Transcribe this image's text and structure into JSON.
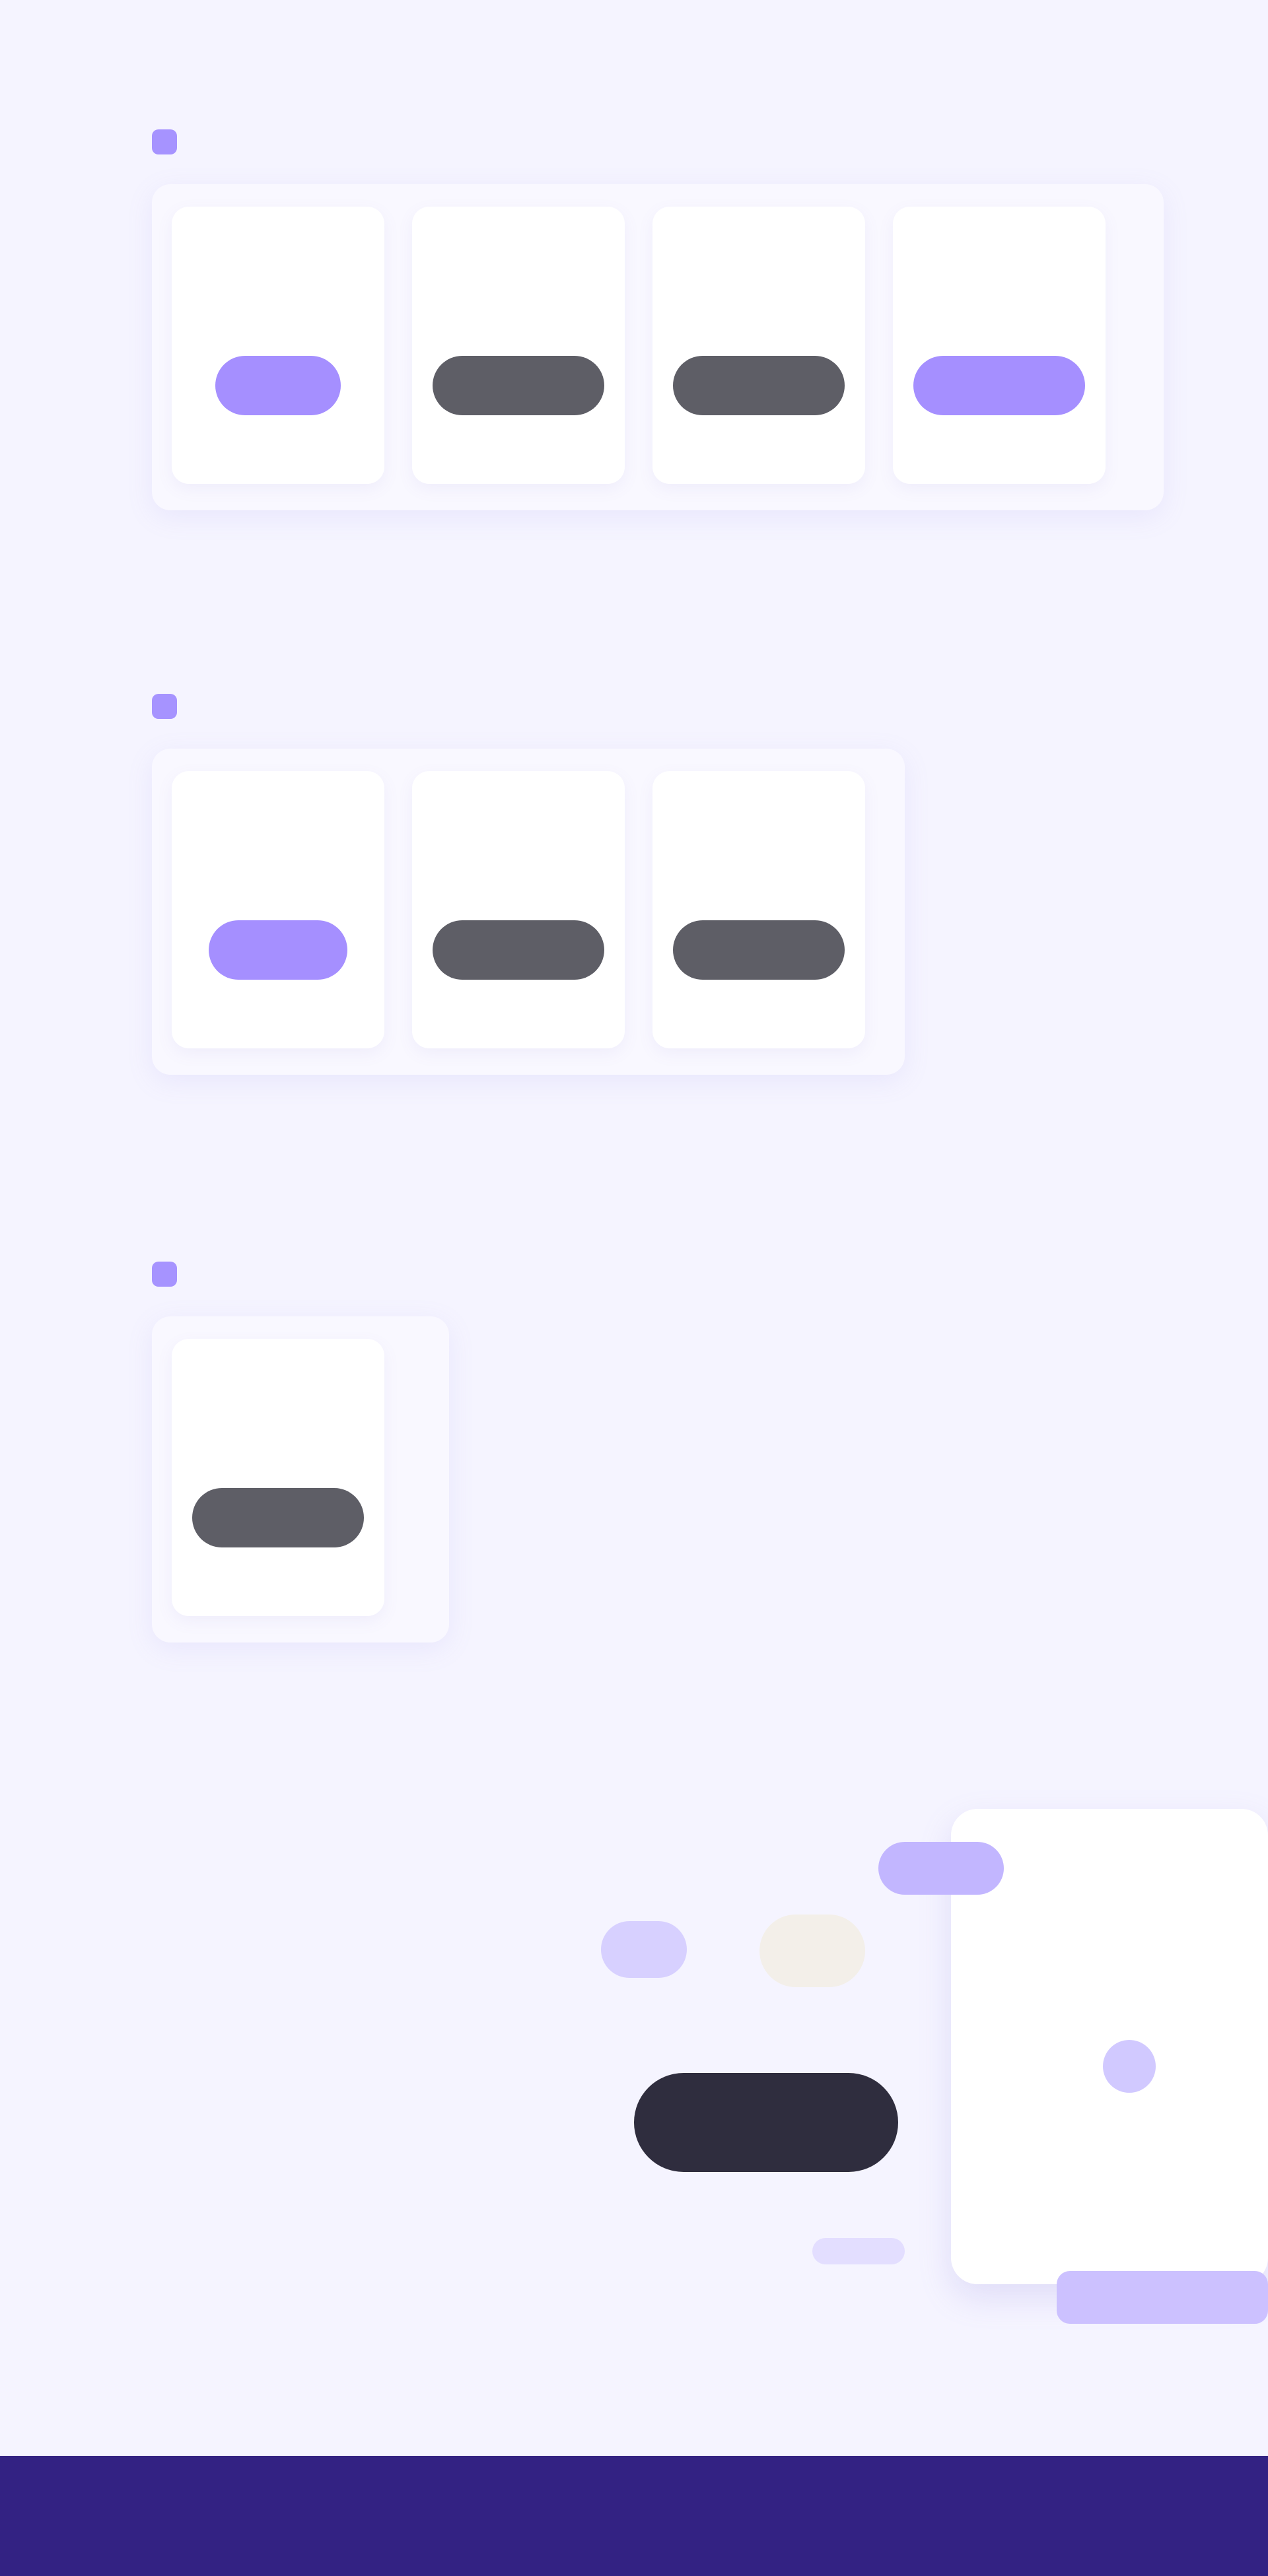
{
  "topbar": {
    "left": "",
    "right": ""
  },
  "sections": [
    {
      "title": "",
      "cards": [
        {
          "name": "",
          "sub": "",
          "button": "",
          "button_color": "#a58fff"
        },
        {
          "name": "",
          "sub": "",
          "button": "",
          "button_color": "#5e5e66"
        },
        {
          "name": "",
          "sub": "",
          "button": "",
          "button_color": "#5e5e66"
        },
        {
          "name": "",
          "sub": "",
          "button": "",
          "button_color": "#a58fff"
        }
      ],
      "link": ""
    },
    {
      "title": "",
      "cards": [
        {
          "name": "",
          "sub": "",
          "button": "",
          "button_color": "#a58fff"
        },
        {
          "name": "",
          "sub": "",
          "button": "",
          "button_color": "#5e5e66"
        },
        {
          "name": "",
          "sub": "",
          "button": "",
          "button_color": "#5e5e66"
        }
      ],
      "link": ""
    },
    {
      "title": "",
      "cards": [
        {
          "name": "",
          "sub": "",
          "button": "",
          "button_color": "#5e5e66"
        }
      ],
      "link": ""
    }
  ],
  "promo": {
    "heading": "",
    "description": "",
    "link": "",
    "tag": "",
    "cta": ""
  },
  "footer": {
    "text": ""
  },
  "colors": {
    "background": "#f5f4ff",
    "accent": "#a58fff",
    "footer": "#332283",
    "button_dark": "#5e5e66"
  }
}
